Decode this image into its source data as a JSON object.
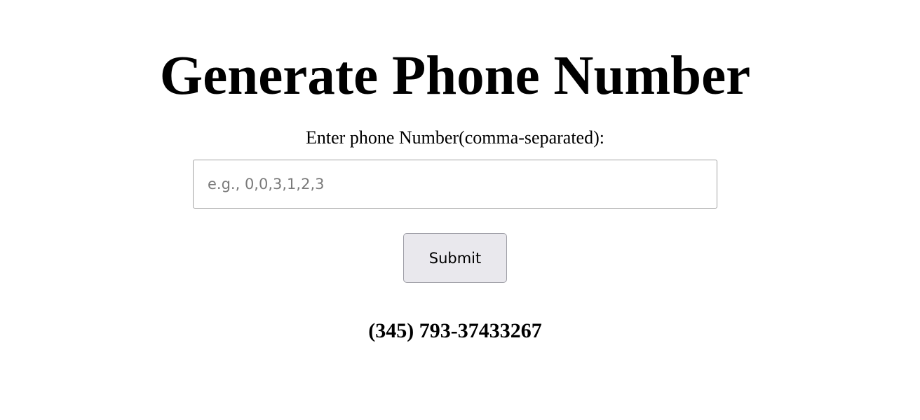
{
  "header": {
    "title": "Generate Phone Number"
  },
  "form": {
    "label": "Enter phone Number(comma-separated):",
    "input_value": "",
    "input_placeholder": "e.g., 0,0,3,1,2,3",
    "submit_label": "Submit"
  },
  "result": {
    "phone_number": "(345) 793-37433267"
  }
}
